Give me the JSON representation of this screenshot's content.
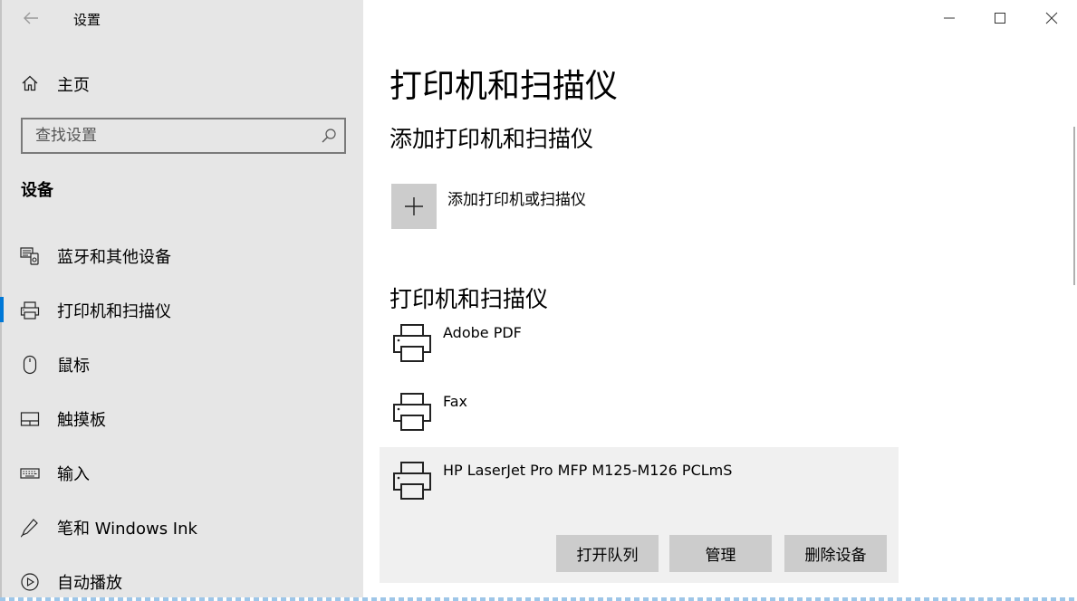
{
  "window": {
    "title": "设置",
    "controls": {
      "minimize": "minimize-icon",
      "maximize": "maximize-icon",
      "close": "close-icon"
    }
  },
  "sidebar": {
    "home_label": "主页",
    "search_placeholder": "查找设置",
    "section_label": "设备",
    "items": [
      {
        "label": "蓝牙和其他设备",
        "icon": "bluetooth-devices-icon"
      },
      {
        "label": "打印机和扫描仪",
        "icon": "printer-icon",
        "active": true
      },
      {
        "label": "鼠标",
        "icon": "mouse-icon"
      },
      {
        "label": "触摸板",
        "icon": "touchpad-icon"
      },
      {
        "label": "输入",
        "icon": "keyboard-icon"
      },
      {
        "label": "笔和 Windows Ink",
        "icon": "pen-icon"
      },
      {
        "label": "自动播放",
        "icon": "autoplay-icon"
      }
    ]
  },
  "main": {
    "title": "打印机和扫描仪",
    "add_heading": "添加打印机和扫描仪",
    "add_label": "添加打印机或扫描仪",
    "list_heading": "打印机和扫描仪",
    "devices": [
      {
        "name": "Adobe PDF"
      },
      {
        "name": "Fax"
      },
      {
        "name": "HP LaserJet Pro MFP M125-M126 PCLmS",
        "selected": true
      }
    ],
    "actions": {
      "open_queue": "打开队列",
      "manage": "管理",
      "remove": "删除设备"
    }
  },
  "colors": {
    "accent": "#0078d7",
    "sidebar_bg": "#e6e6e6",
    "button_bg": "#cccccc"
  }
}
